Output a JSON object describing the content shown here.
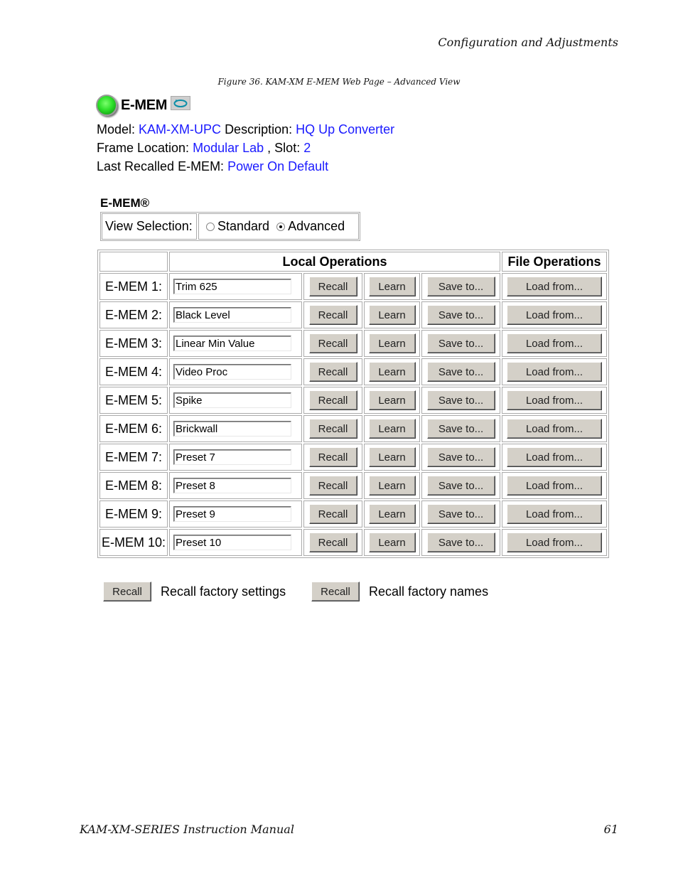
{
  "page_header": "Configuration and Adjustments",
  "figure_caption": "Figure 36.  KAM-XM E-MEM Web Page – Advanced View",
  "app": {
    "title": "E-MEM",
    "status_icon": "green-led-icon",
    "refresh_icon": "refresh-icon"
  },
  "info": {
    "model_label": "Model:",
    "model_value": "KAM-XM-UPC",
    "description_label": "Description:",
    "description_value": "HQ Up Converter",
    "frame_label": "Frame Location:",
    "frame_value": "Modular Lab",
    "slot_label": ", Slot:",
    "slot_value": "2",
    "last_recalled_label": "Last Recalled E-MEM:",
    "last_recalled_value": "Power On Default"
  },
  "emem_section": {
    "heading": "E-MEM®",
    "view_selection_label": "View Selection:",
    "view_options": [
      {
        "label": "Standard",
        "selected": false
      },
      {
        "label": "Advanced",
        "selected": true
      }
    ]
  },
  "table": {
    "headers": {
      "blank": "",
      "local": "Local Operations",
      "file": "File Operations"
    },
    "buttons": {
      "recall": "Recall",
      "learn": "Learn",
      "save": "Save to...",
      "load": "Load from..."
    },
    "rows": [
      {
        "label": "E-MEM 1:",
        "name": "Trim 625"
      },
      {
        "label": "E-MEM 2:",
        "name": "Black Level"
      },
      {
        "label": "E-MEM 3:",
        "name": "Linear Min Value"
      },
      {
        "label": "E-MEM 4:",
        "name": "Video Proc"
      },
      {
        "label": "E-MEM 5:",
        "name": "Spike"
      },
      {
        "label": "E-MEM 6:",
        "name": "Brickwall"
      },
      {
        "label": "E-MEM 7:",
        "name": "Preset 7"
      },
      {
        "label": "E-MEM 8:",
        "name": "Preset 8"
      },
      {
        "label": "E-MEM 9:",
        "name": "Preset 9"
      },
      {
        "label": "E-MEM 10:",
        "name": "Preset 10"
      }
    ]
  },
  "factory": {
    "settings_button": "Recall",
    "settings_label": "Recall factory settings",
    "names_button": "Recall",
    "names_label": "Recall factory names"
  },
  "page_footer": {
    "manual_title": "KAM-XM-SERIES Instruction Manual",
    "page_number": "61"
  }
}
